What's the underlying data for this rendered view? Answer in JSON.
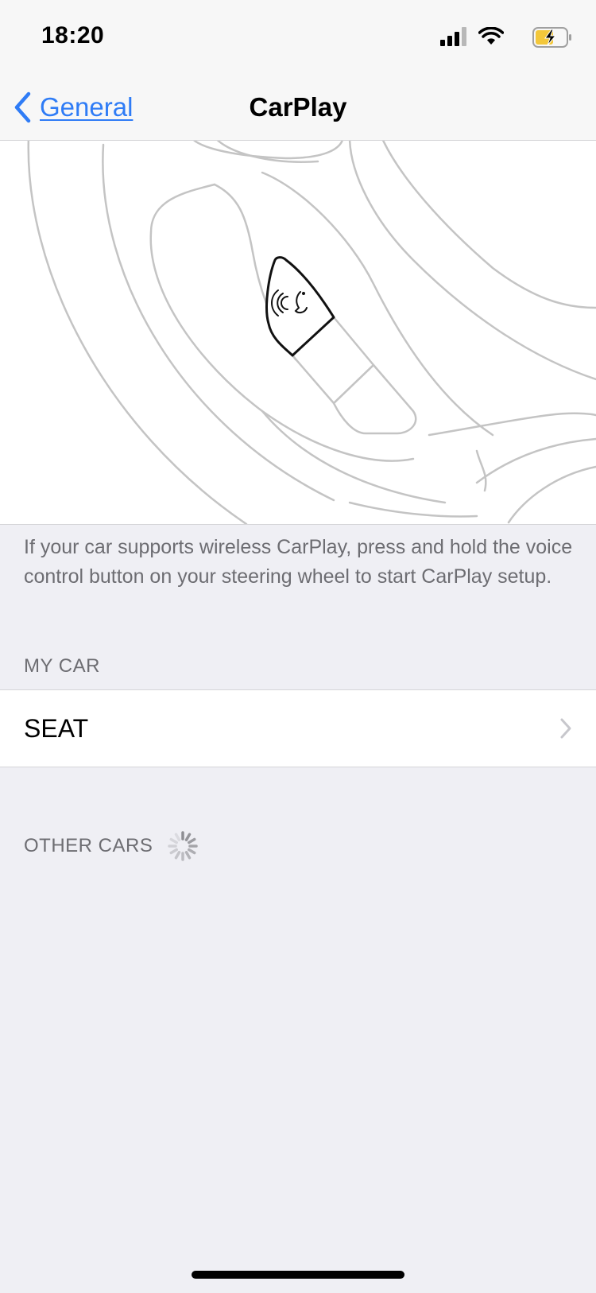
{
  "status_bar": {
    "time": "18:20",
    "icons": [
      "signal-icon",
      "wifi-icon",
      "battery-charging-icon"
    ]
  },
  "nav": {
    "back_label": "General",
    "title": "CarPlay",
    "accent_color": "#2f7cf6"
  },
  "illustration": {
    "icon": "steering-wheel-voice-button-illustration"
  },
  "info_text": "If your car supports wireless CarPlay, press and hold the voice control button on your steering wheel to start CarPlay setup.",
  "sections": {
    "my_car": {
      "header": "MY CAR",
      "rows": [
        {
          "label": "SEAT"
        }
      ]
    },
    "other_cars": {
      "header": "OTHER CARS",
      "loading": true
    }
  }
}
